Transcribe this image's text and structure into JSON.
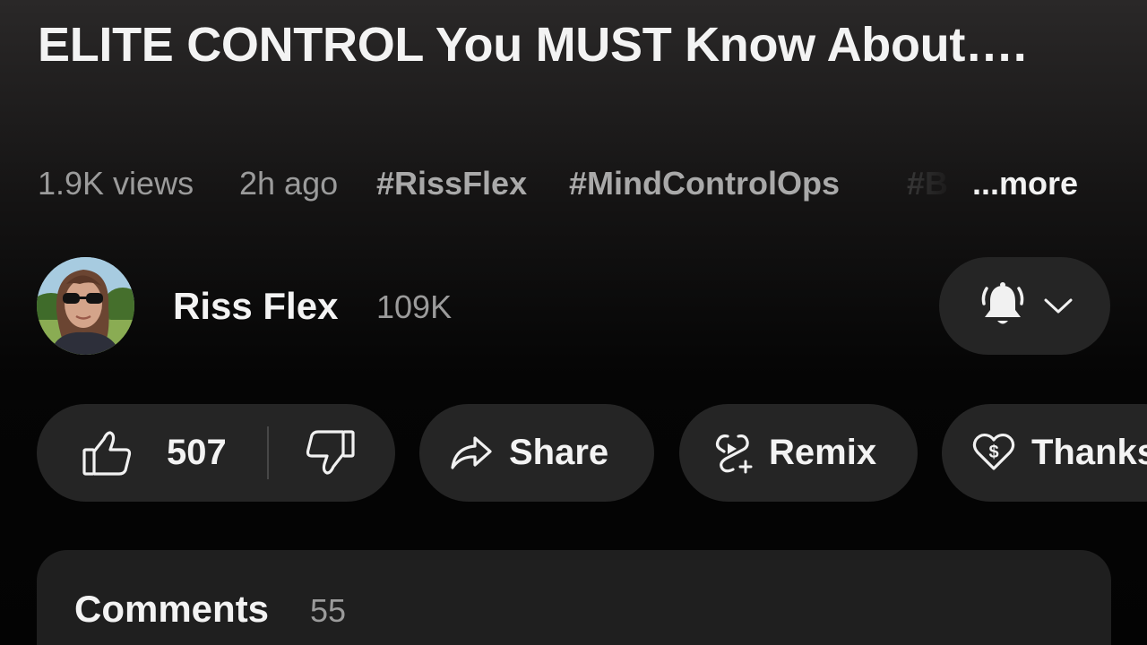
{
  "video": {
    "title": "ELITE CONTROL You MUST Know About….",
    "views": "1.9K views",
    "age": "2h ago",
    "hashtags": [
      "#RissFlex",
      "#MindControlOps",
      "#B"
    ],
    "more_label": "...more"
  },
  "channel": {
    "name": "Riss Flex",
    "subscribers": "109K",
    "notification_icon": "bell-icon",
    "dropdown_icon": "chevron-down-icon"
  },
  "actions": {
    "like_count": "507",
    "share_label": "Share",
    "remix_label": "Remix",
    "thanks_label": "Thanks"
  },
  "comments": {
    "title": "Comments",
    "count": "55"
  },
  "colors": {
    "background": "#0b0b0b",
    "pill": "#252525",
    "secondary_text": "#9b9b9b",
    "primary_text": "#f3f3f3"
  }
}
